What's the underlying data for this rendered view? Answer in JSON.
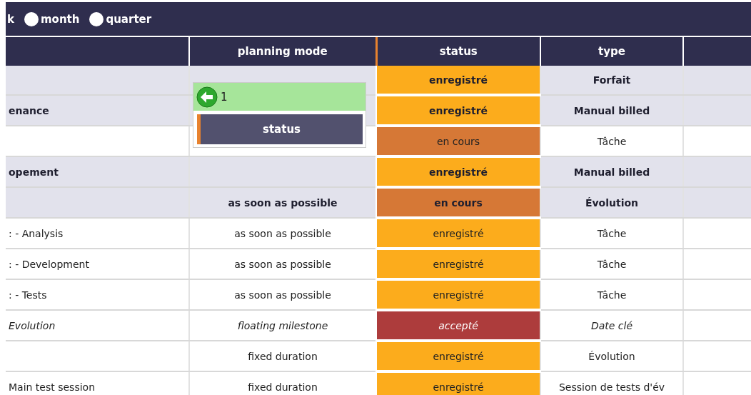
{
  "toolbar": {
    "options": [
      {
        "kind": "label",
        "label": "k",
        "selected": false
      },
      {
        "kind": "radio",
        "label": "month",
        "selected": false
      },
      {
        "kind": "radio",
        "label": "quarter",
        "selected": false
      }
    ]
  },
  "table": {
    "columns": [
      "",
      "planning mode",
      "status",
      "type",
      ""
    ],
    "rows": [
      {
        "kind": "group",
        "name": "",
        "planning_mode": "",
        "status": "enregistré",
        "color": "#fcac1c",
        "type": "Forfait"
      },
      {
        "kind": "group",
        "name": "enance",
        "planning_mode": "",
        "status": "enregistré",
        "color": "#fcac1c",
        "type": "Manual billed"
      },
      {
        "kind": "task",
        "name": "",
        "planning_mode": "",
        "status": "en cours",
        "color": "#d67836",
        "type": "Tâche"
      },
      {
        "kind": "group",
        "name": "opement",
        "planning_mode": "",
        "status": "enregistré",
        "color": "#fcac1c",
        "type": "Manual billed"
      },
      {
        "kind": "group",
        "name": "",
        "planning_mode": "as soon as possible",
        "status": "en cours",
        "color": "#d67836",
        "type": "Évolution"
      },
      {
        "kind": "task",
        "name": ": - Analysis",
        "planning_mode": "as soon as possible",
        "status": "enregistré",
        "color": "#fcac1c",
        "type": "Tâche"
      },
      {
        "kind": "task",
        "name": ": - Development",
        "planning_mode": "as soon as possible",
        "status": "enregistré",
        "color": "#fcac1c",
        "type": "Tâche"
      },
      {
        "kind": "task",
        "name": ": - Tests",
        "planning_mode": "as soon as possible",
        "status": "enregistré",
        "color": "#fcac1c",
        "type": "Tâche"
      },
      {
        "kind": "milestone",
        "name": "Evolution",
        "planning_mode": "floating milestone",
        "status": "accepté",
        "color": "#ad3c3c",
        "type": "Date clé"
      },
      {
        "kind": "task",
        "name": "",
        "planning_mode": "fixed duration",
        "status": "enregistré",
        "color": "#fcac1c",
        "type": "Évolution"
      },
      {
        "kind": "task",
        "name": "Main test session",
        "planning_mode": "fixed duration",
        "status": "enregistré",
        "color": "#fcac1c",
        "type": "Session de tests d'év"
      }
    ]
  },
  "drag_tooltip": {
    "count": "1",
    "column": "status"
  }
}
